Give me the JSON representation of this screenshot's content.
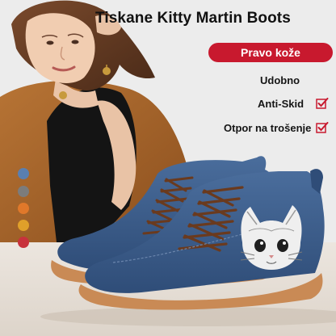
{
  "title": "Tiskane Kitty Martin Boots",
  "badge": "Pravo kože",
  "features": [
    "Udobno",
    "Anti-Skid",
    "Otpor na trošenje"
  ],
  "feature_icons": [
    "none",
    "checkmark-icon",
    "checkmark-icon"
  ],
  "colors": {
    "badge": "#c8192e",
    "check": "#c8192e",
    "swatches": [
      "#5a7fb0",
      "#7c7c7c",
      "#e0782a",
      "#e0a02a",
      "#c8323c"
    ]
  }
}
